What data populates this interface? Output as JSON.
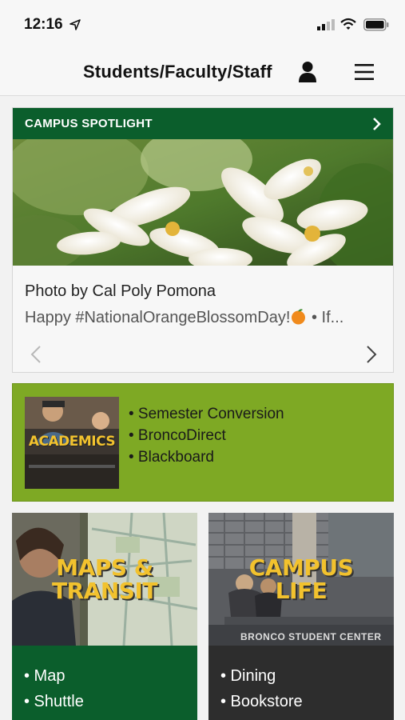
{
  "status_bar": {
    "time": "12:16"
  },
  "nav": {
    "title": "Students/Faculty/Staff"
  },
  "spotlight": {
    "header": "CAMPUS SPOTLIGHT",
    "credit": "Photo by Cal Poly Pomona",
    "caption": "Happy #NationalOrangeBlossomDay!",
    "caption_suffix": " • If..."
  },
  "academics": {
    "label": "ACADEMICS",
    "links": [
      "• Semester Conversion",
      "• BroncoDirect",
      "• Blackboard"
    ]
  },
  "tiles": [
    {
      "title_line1": "MAPS &",
      "title_line2": "TRANSIT",
      "links": [
        "• Map",
        "• Shuttle"
      ]
    },
    {
      "title_line1": "CAMPUS",
      "title_line2": "LIFE",
      "sign": "BRONCO STUDENT CENTER",
      "links": [
        "• Dining",
        "• Bookstore"
      ]
    }
  ],
  "colors": {
    "brand_green": "#0b5e2c",
    "lime": "#7ea924",
    "gold": "#f2c22e",
    "dark": "#2d2d2d"
  }
}
